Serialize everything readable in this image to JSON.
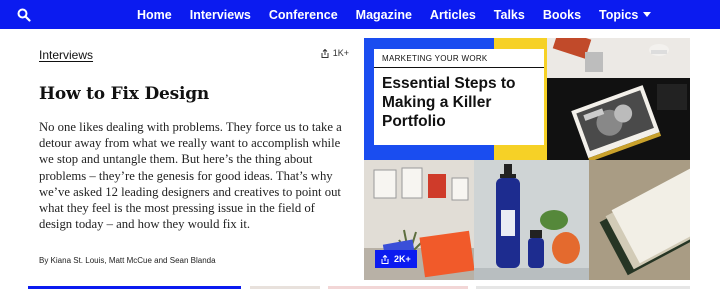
{
  "nav": {
    "search_icon": "search-icon",
    "items": [
      {
        "label": "Home"
      },
      {
        "label": "Interviews"
      },
      {
        "label": "Conference"
      },
      {
        "label": "Magazine"
      },
      {
        "label": "Articles"
      },
      {
        "label": "Talks"
      },
      {
        "label": "Books"
      },
      {
        "label": "Topics"
      }
    ],
    "bg_color": "#0b1bf0"
  },
  "article": {
    "category": "Interviews",
    "share_count": "1K+",
    "title": "How to Fix Design",
    "dek": "No one likes dealing with problems. They force us to take a detour away from what we really want to accomplish while we stop and untangle them. But here’s the thing about problems – they’re the genesis for good ideas. That’s why we’ve asked 12 leading designers and creatives to point out what they feel is the most pressing issue in the field of design today – and how they would fix it.",
    "byline": "By Kiana St. Louis, Matt McCue and Sean Blanda"
  },
  "feature": {
    "kicker": "MARKETING YOUR WORK",
    "title": "Essential Steps to Making a Killer Portfolio",
    "share_count": "2K+",
    "accent_color": "#1a4df0"
  }
}
